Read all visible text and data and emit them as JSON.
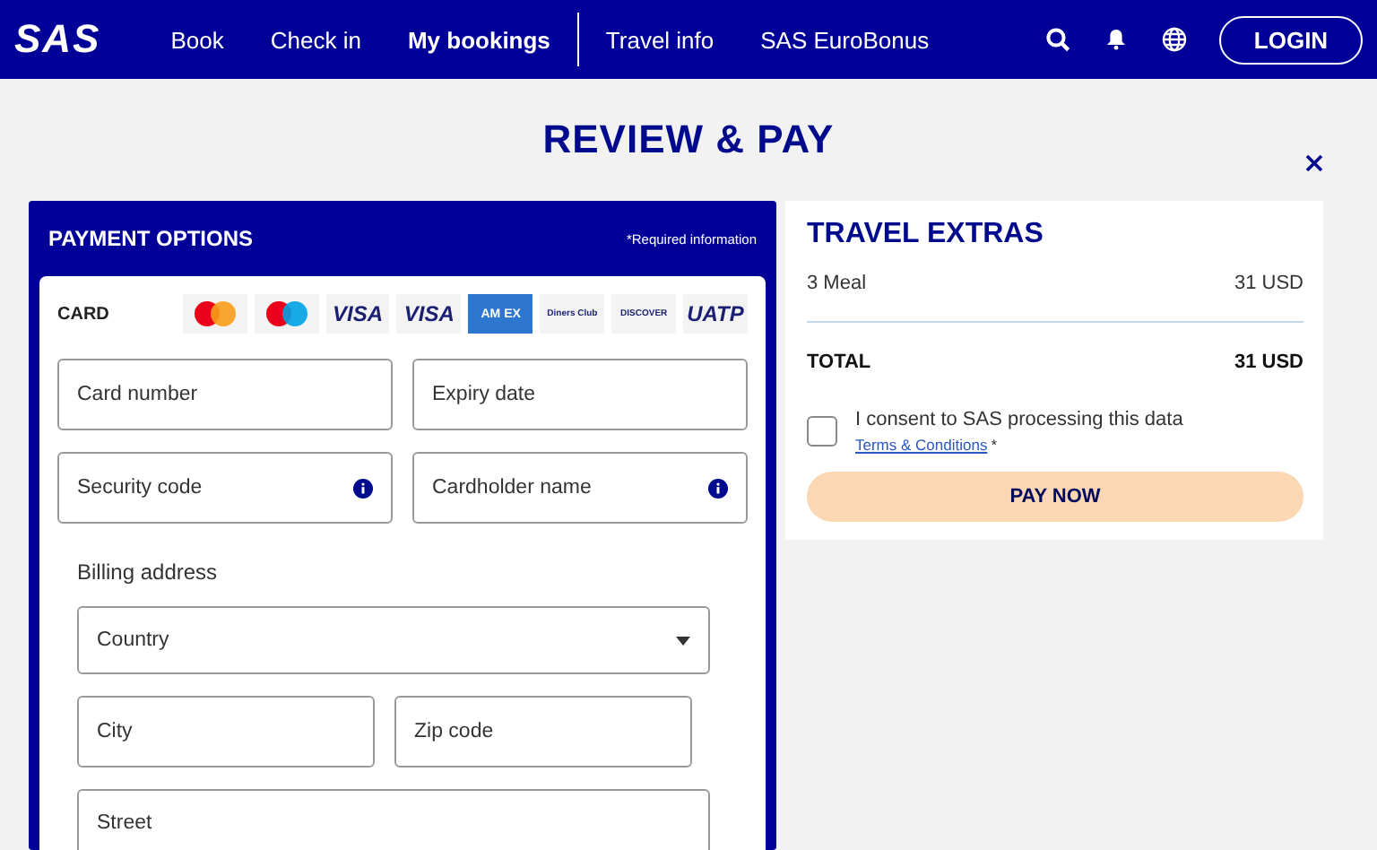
{
  "nav": {
    "logo": "SAS",
    "links": [
      {
        "label": "Book",
        "selected": false
      },
      {
        "label": "Check in",
        "selected": false
      },
      {
        "label": "My bookings",
        "selected": true
      },
      {
        "label": "Travel info",
        "selected": false
      },
      {
        "label": "SAS EuroBonus",
        "selected": false
      }
    ],
    "login": "LOGIN"
  },
  "page_title": "REVIEW & PAY",
  "payment": {
    "title": "PAYMENT OPTIONS",
    "required_note": "*Required information",
    "card_label": "CARD",
    "cards": [
      {
        "kind": "mastercard"
      },
      {
        "kind": "maestro"
      },
      {
        "kind": "text",
        "label": "VISA"
      },
      {
        "kind": "text",
        "label": "VISA"
      },
      {
        "kind": "amex",
        "label": "AM EX"
      },
      {
        "kind": "diners",
        "label": "Diners Club"
      },
      {
        "kind": "small",
        "label": "DISCOVER"
      },
      {
        "kind": "text",
        "label": "UATP"
      }
    ],
    "fields": [
      {
        "placeholder": "Card number",
        "info": false
      },
      {
        "placeholder": "Expiry date",
        "info": false
      },
      {
        "placeholder": "Security code",
        "info": true
      },
      {
        "placeholder": "Cardholder name",
        "info": true
      }
    ],
    "billing_label": "Billing address",
    "country": {
      "placeholder": "Country"
    },
    "address_fields": [
      {
        "placeholder": "City"
      },
      {
        "placeholder": "Zip code"
      }
    ],
    "street": {
      "placeholder": "Street"
    }
  },
  "extras": {
    "title": "TRAVEL EXTRAS",
    "items": [
      {
        "name": "3 Meal",
        "price": "31 USD"
      }
    ],
    "total_label": "TOTAL",
    "total": "31 USD",
    "consent": {
      "text": "I consent to SAS processing this data",
      "link": "Terms & Conditions",
      "mark": "*",
      "checked": false
    },
    "pay_button": "PAY NOW"
  }
}
